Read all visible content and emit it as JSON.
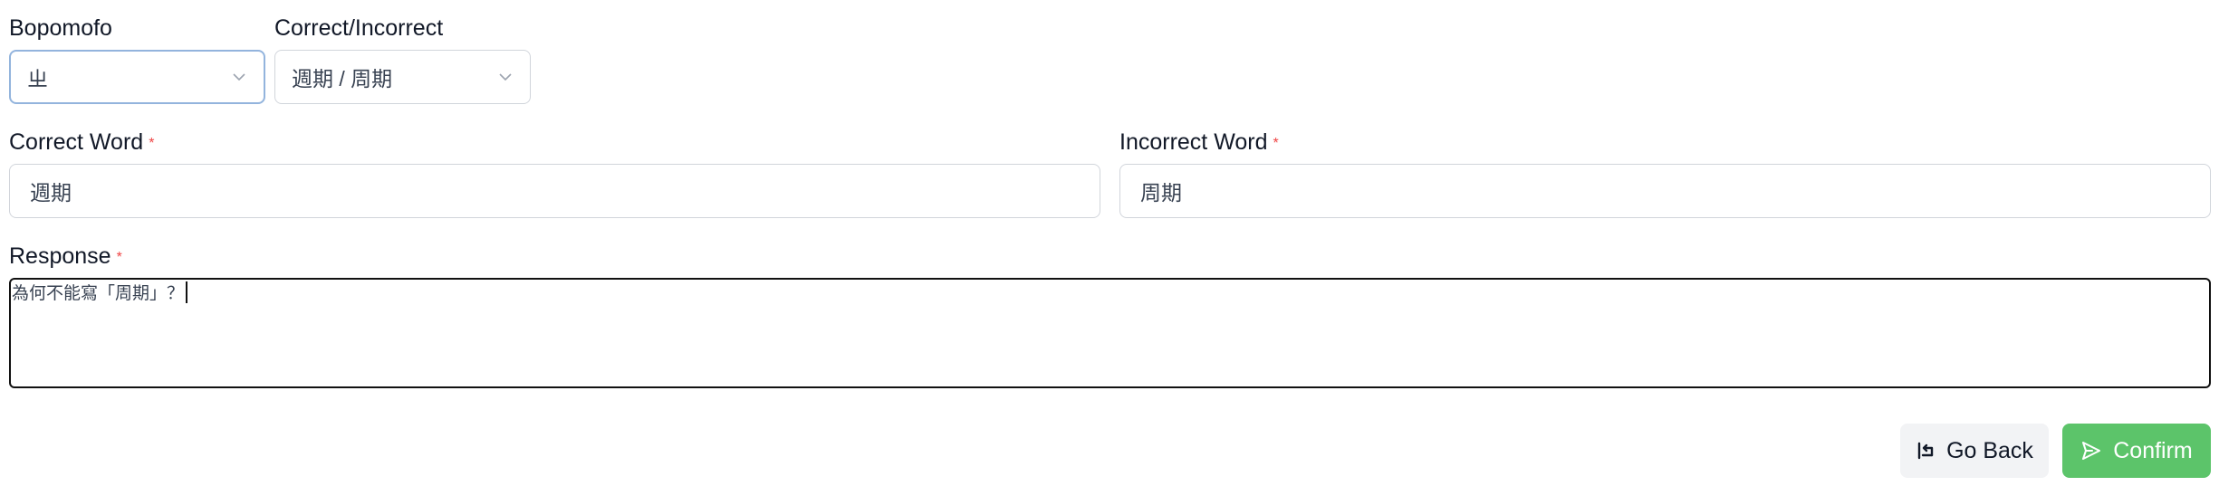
{
  "bopomofo": {
    "label": "Bopomofo",
    "selected": "ㄓ",
    "icon": "chevron-down-icon"
  },
  "correct_incorrect": {
    "label": "Correct/Incorrect",
    "selected": "週期 / 周期",
    "icon": "chevron-down-icon"
  },
  "correct_word": {
    "label": "Correct Word",
    "required_marker": "*",
    "value": "週期"
  },
  "incorrect_word": {
    "label": "Incorrect Word",
    "required_marker": "*",
    "value": "周期"
  },
  "response": {
    "label": "Response",
    "required_marker": "*",
    "value": "為何不能寫「周期」？"
  },
  "actions": {
    "go_back_label": "Go Back",
    "go_back_icon": "return-arrow-icon",
    "confirm_label": "Confirm",
    "confirm_icon": "send-icon"
  },
  "colors": {
    "confirm_bg": "#5cc46a",
    "go_back_bg": "#f2f3f5",
    "required": "#ef4444",
    "focus_border": "#93b4dd"
  }
}
